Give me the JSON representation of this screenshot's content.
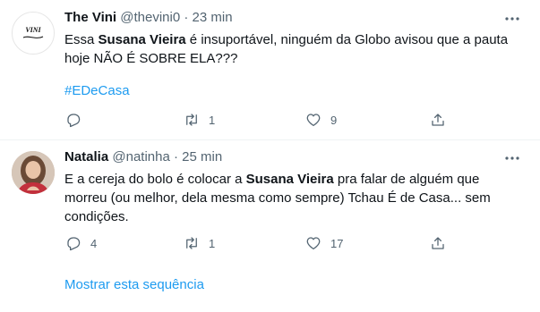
{
  "tweets": [
    {
      "name": "The Vini",
      "handle": "@thevini0",
      "separator": "·",
      "time": "23 min",
      "text_parts": [
        "Essa ",
        "Susana Vieira",
        " é insuportável, ninguém da Globo avisou que a pauta hoje NÃO É SOBRE ELA???"
      ],
      "hashtag": "#EDeCasa",
      "avatar_text": "VINI",
      "replies": "",
      "retweets": "1",
      "likes": "9"
    },
    {
      "name": "Natalia",
      "handle": "@natinha",
      "separator": "·",
      "time": "25 min",
      "text_parts": [
        "E a cereja do bolo é colocar a ",
        "Susana Vieira",
        " pra falar de alguém que morreu (ou melhor, dela mesma como sempre) Tchau É de Casa... sem condições."
      ],
      "replies": "4",
      "retweets": "1",
      "likes": "17"
    }
  ],
  "show_thread_label": "Mostrar esta sequência",
  "colors": {
    "accent": "#1d9bf0",
    "muted": "#536471",
    "text": "#0f1419"
  }
}
